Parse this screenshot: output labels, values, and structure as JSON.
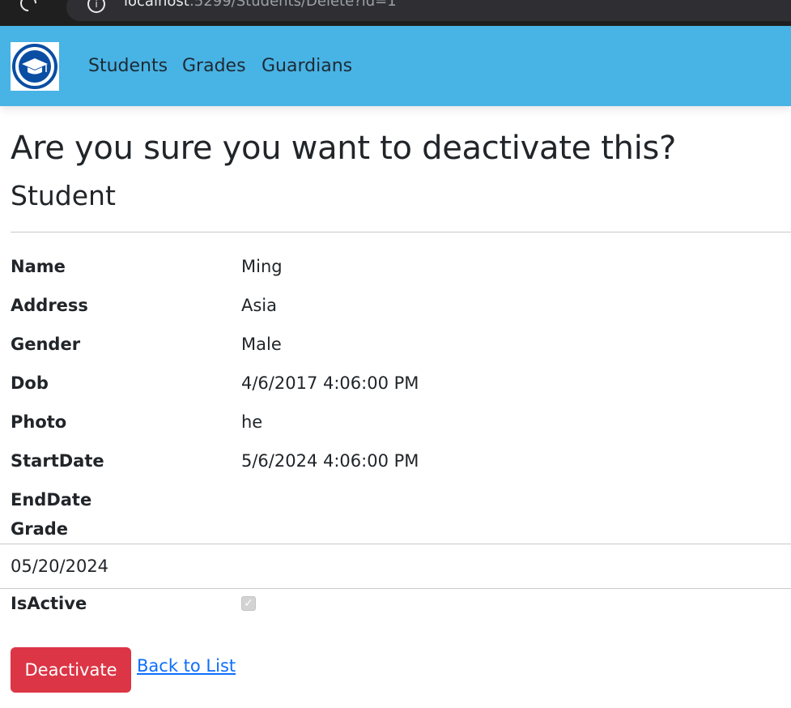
{
  "browser": {
    "url_host": "localhost",
    "url_rest": ":5299/Students/Delete?id=1"
  },
  "navbar": {
    "logo_icon": "graduation-cap-icon",
    "links": [
      "Students",
      "Grades",
      "Guardians"
    ]
  },
  "heading": "Are you sure you want to deactivate this?",
  "subheading": "Student",
  "fields": [
    {
      "label": "Name",
      "value": "Ming"
    },
    {
      "label": "Address",
      "value": "Asia"
    },
    {
      "label": "Gender",
      "value": "Male"
    },
    {
      "label": "Dob",
      "value": "4/6/2017 4:06:00 PM"
    },
    {
      "label": "Photo",
      "value": "he"
    },
    {
      "label": "StartDate",
      "value": "5/6/2024 4:06:00 PM"
    },
    {
      "label": "EndDate",
      "value": ""
    },
    {
      "label": "Grade",
      "value": ""
    }
  ],
  "date_input_value": "05/20/2024",
  "is_active": {
    "label": "IsActive",
    "checked": true
  },
  "actions": {
    "deactivate_label": "Deactivate",
    "back_label": "Back to List"
  },
  "colors": {
    "navbar": "#48b3e5",
    "danger": "#dc3545",
    "link": "#0d6efd",
    "logo_circle": "#0a4ea3"
  }
}
